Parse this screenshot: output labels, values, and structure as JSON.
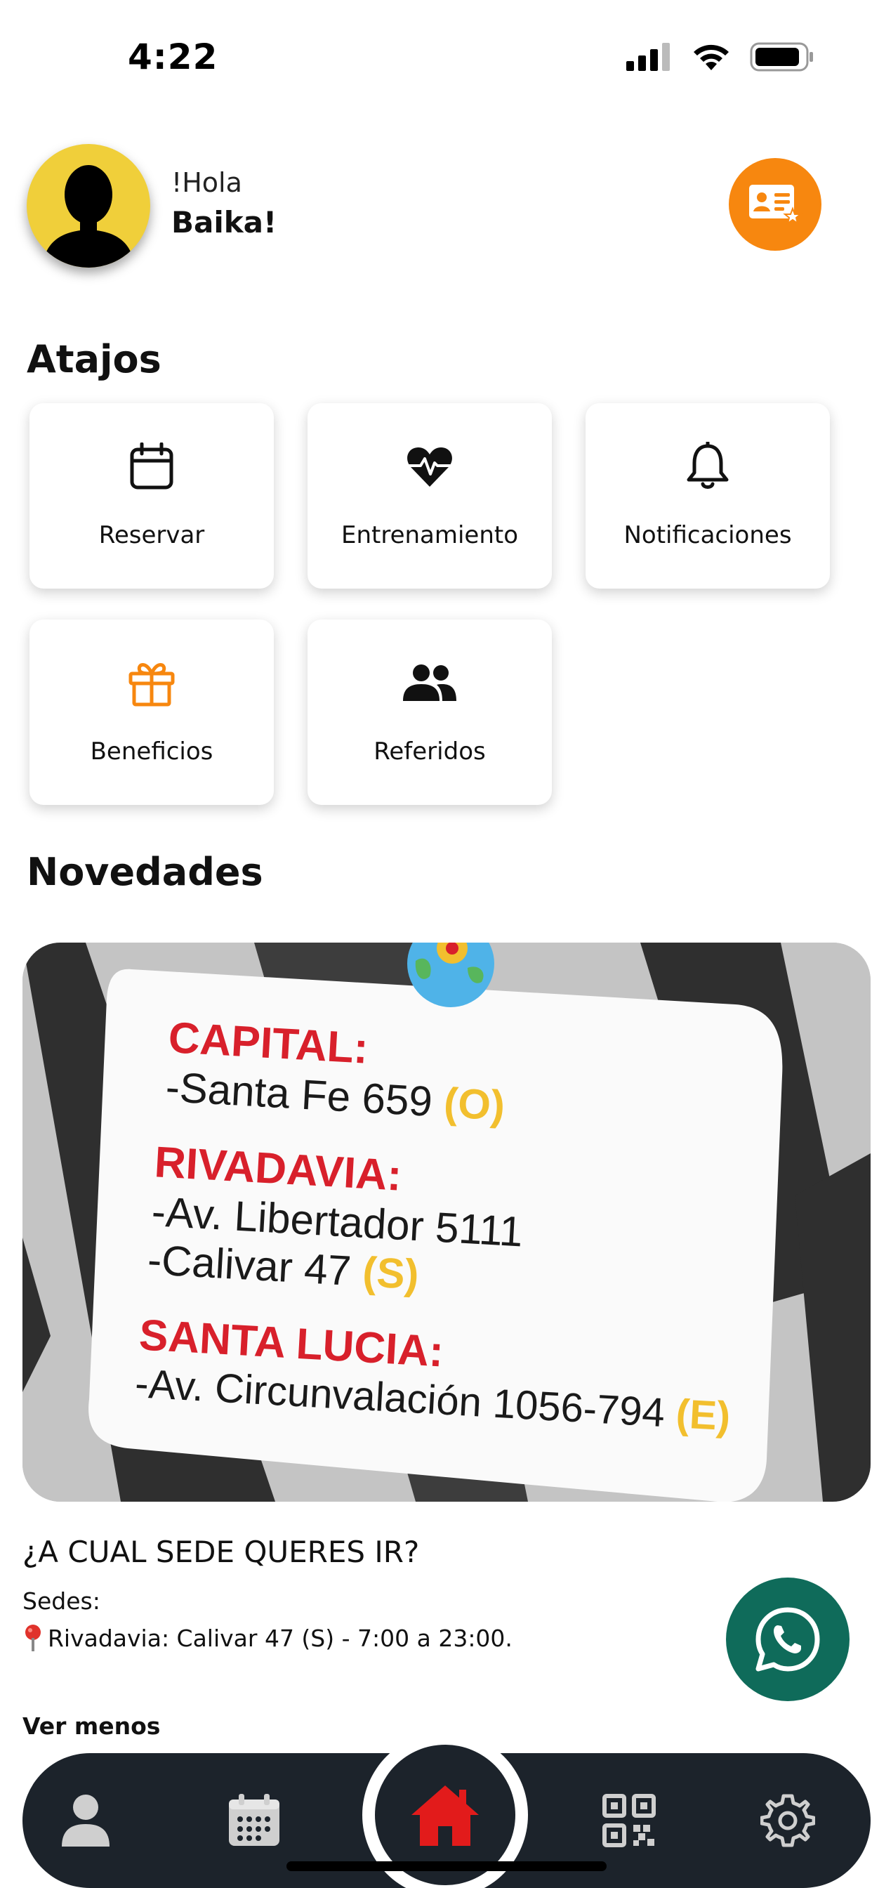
{
  "status_bar": {
    "time": "4:22"
  },
  "header": {
    "greeting": "!Hola",
    "user_name": "Baika!"
  },
  "shortcuts": {
    "title": "Atajos",
    "items": [
      {
        "label": "Reservar",
        "icon": "calendar-icon"
      },
      {
        "label": "Entrenamiento",
        "icon": "heart-pulse-icon"
      },
      {
        "label": "Notificaciones",
        "icon": "bell-icon"
      },
      {
        "label": "Beneficios",
        "icon": "gift-icon"
      },
      {
        "label": "Referidos",
        "icon": "users-icon"
      }
    ]
  },
  "news": {
    "title": "Novedades",
    "promo": {
      "sections": [
        {
          "heading": "CAPITAL:",
          "lines": [
            {
              "text": "-Santa Fe 659",
              "tag": "(O)"
            }
          ]
        },
        {
          "heading": "RIVADAVIA:",
          "lines": [
            {
              "text": "-Av. Libertador 5111",
              "tag": ""
            },
            {
              "text": "-Calivar 47",
              "tag": "(S)"
            }
          ]
        },
        {
          "heading": "SANTA LUCIA:",
          "lines": [
            {
              "text": "-Av. Circunvalación 1056-794",
              "tag": "(E)"
            }
          ]
        }
      ]
    },
    "post_title": "¿A CUAL SEDE QUERES IR?",
    "post_sedes": "Sedes:",
    "post_line": "Rivadavia: Calivar 47 (S) - 7:00 a 23:00.",
    "toggle_label": "Ver menos"
  },
  "colors": {
    "accent_orange": "#f7870f",
    "avatar_yellow": "#f0cf3a",
    "nav_dark": "#1c232b",
    "home_red": "#e21b1b",
    "whatsapp_green": "#0f6b5a",
    "promo_red": "#d8202b",
    "promo_yellow": "#f2bf2e"
  },
  "nav": {
    "items": [
      "profile-icon",
      "calendar-grid-icon",
      "home-icon",
      "qr-code-icon",
      "settings-icon"
    ]
  }
}
